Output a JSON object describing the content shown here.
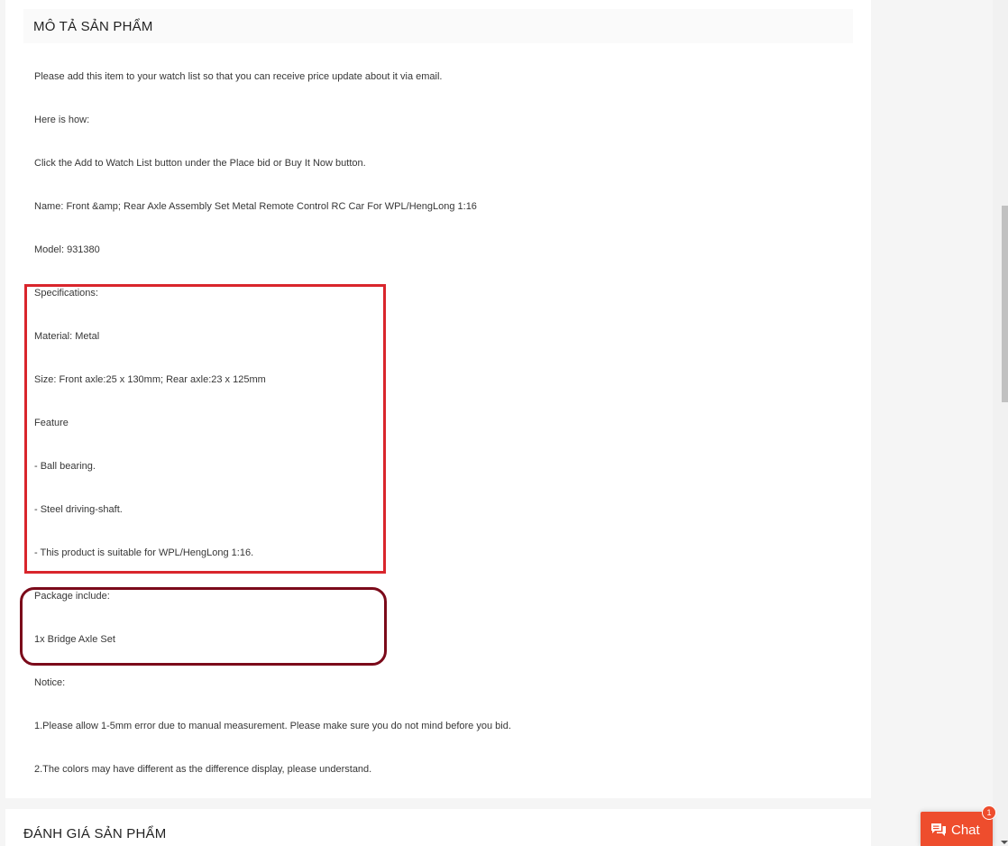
{
  "description_section": {
    "title": "MÔ TẢ SẢN PHẨM",
    "lines": [
      "Please add this item to your watch list so that you can receive price update about it via email.",
      "Here is how:",
      "Click the Add to Watch List button under the Place bid or Buy It Now button.",
      "Name: Front &amp; Rear Axle Assembly Set Metal Remote Control RC Car For WPL/HengLong 1:16",
      "Model: 931380",
      "Specifications:",
      "Material: Metal",
      "Size: Front axle:25 x 130mm; Rear axle:23 x 125mm",
      "Feature",
      "- Ball bearing.",
      "- Steel driving-shaft.",
      "- This product is suitable for WPL/HengLong 1:16.",
      "Package include:",
      "1x Bridge Axle Set",
      "Notice:",
      "1.Please allow 1-5mm error due to manual measurement. Please make sure you do not mind before you bid.",
      "2.The colors may have different as the difference display, please understand."
    ]
  },
  "rating_section": {
    "title": "ĐÁNH GIÁ SẢN PHẨM"
  },
  "chat": {
    "label": "Chat",
    "badge_count": "1",
    "icon": "chat-bubble-icon"
  },
  "colors": {
    "accent": "#ee4d2d",
    "highlight_red": "#d9252c",
    "highlight_dark_red": "#7b0a1a"
  }
}
